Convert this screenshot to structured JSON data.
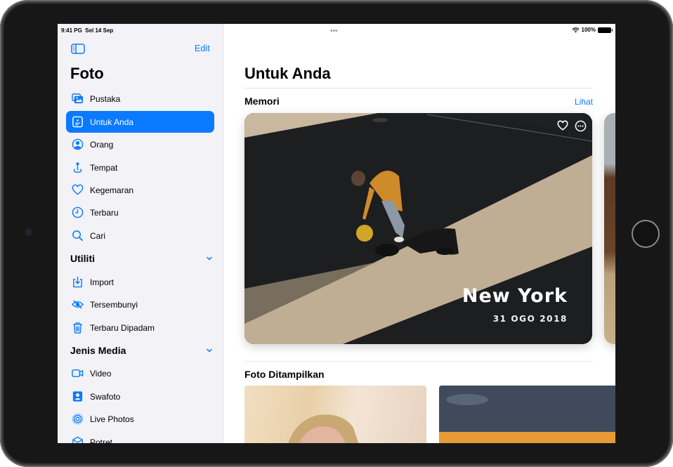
{
  "status_bar": {
    "time": "9:41 PG",
    "date": "Sel 14 Sep",
    "battery": "100%",
    "wifi_icon": "wifi-icon",
    "multitask_indicator": "•••"
  },
  "sidebar": {
    "edit_label": "Edit",
    "title": "Foto",
    "items": [
      {
        "label": "Pustaka",
        "icon": "photo-library-icon",
        "active": false
      },
      {
        "label": "Untuk Anda",
        "icon": "for-you-icon",
        "active": true
      },
      {
        "label": "Orang",
        "icon": "person-circle-icon",
        "active": false
      },
      {
        "label": "Tempat",
        "icon": "map-pin-icon",
        "active": false
      },
      {
        "label": "Kegemaran",
        "icon": "heart-icon",
        "active": false
      },
      {
        "label": "Terbaru",
        "icon": "clock-icon",
        "active": false
      },
      {
        "label": "Cari",
        "icon": "search-icon",
        "active": false
      }
    ],
    "sections": [
      {
        "title": "Utiliti",
        "expanded": true,
        "items": [
          {
            "label": "Import",
            "icon": "import-icon"
          },
          {
            "label": "Tersembunyi",
            "icon": "eye-slash-icon"
          },
          {
            "label": "Terbaru Dipadam",
            "icon": "trash-icon"
          }
        ]
      },
      {
        "title": "Jenis Media",
        "expanded": true,
        "items": [
          {
            "label": "Video",
            "icon": "video-icon"
          },
          {
            "label": "Swafoto",
            "icon": "selfie-icon"
          },
          {
            "label": "Live Photos",
            "icon": "live-photo-icon"
          },
          {
            "label": "Potret",
            "icon": "portrait-cube-icon"
          }
        ]
      }
    ]
  },
  "main": {
    "title": "Untuk Anda",
    "memories": {
      "section_title": "Memori",
      "see_all_label": "Lihat",
      "card": {
        "title": "New York",
        "date": "31 OGO 2018"
      }
    },
    "featured": {
      "section_title": "Foto Ditampilkan"
    }
  },
  "colors": {
    "accent": "#0a7aff",
    "sidebar_bg": "#f2f2f7"
  }
}
